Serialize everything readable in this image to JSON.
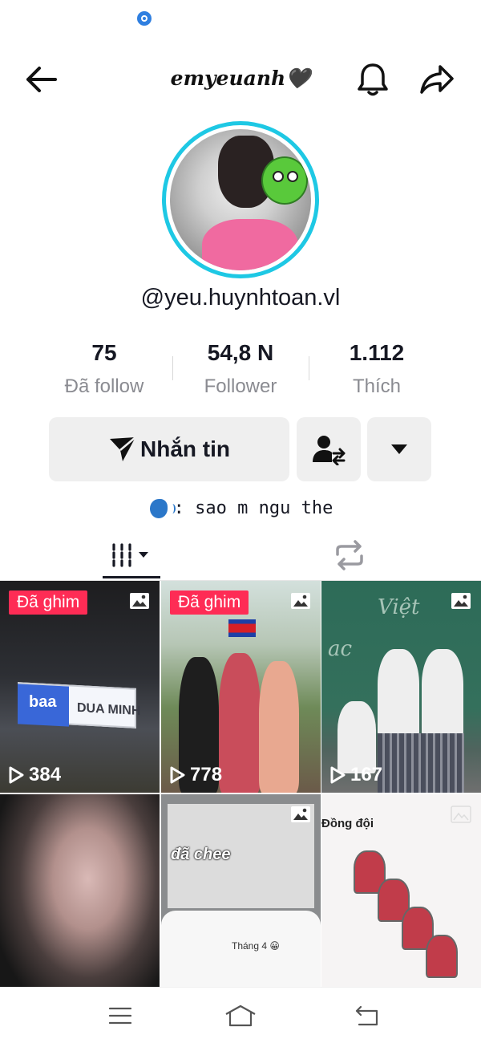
{
  "header": {
    "title": "emyeuanh🖤"
  },
  "profile": {
    "username": "@yeu.huynhtoan.vl",
    "bio_text": ": sao m ngu the"
  },
  "stats": [
    {
      "value": "75",
      "label": "Đã follow"
    },
    {
      "value": "54,8 N",
      "label": "Follower"
    },
    {
      "value": "1.112",
      "label": "Thích"
    }
  ],
  "actions": {
    "message_label": "Nhắn tin"
  },
  "icons": {
    "back": "arrow-left-icon",
    "notifications": "bell-icon",
    "share": "share-icon",
    "send": "paper-plane-icon",
    "suggest": "user-swap-icon",
    "more": "caret-down-icon",
    "videos_tab": "grid-columns-icon",
    "reposts_tab": "repost-icon",
    "nav_menu": "menu-icon",
    "nav_home": "home-icon",
    "nav_back": "back-icon"
  },
  "videos": [
    {
      "pinned_label": "Đã ghim",
      "views": "384",
      "sign_left": "baa",
      "sign_right": "DUA MINH"
    },
    {
      "pinned_label": "Đã ghim",
      "views": "778"
    },
    {
      "views": "167",
      "chalk_1": "Việt",
      "chalk_2": "ac"
    },
    {
      "views": ""
    },
    {
      "views": "",
      "overlay_text": "đã chee",
      "sheet_text": "Tháng 4 😀"
    },
    {
      "views": "",
      "caption": "Đồng đội"
    }
  ],
  "colors": {
    "accent_pink": "#fe2c55",
    "ring_cyan": "#1ec8e4",
    "button_bg": "#efefef",
    "text_primary": "#161823",
    "text_secondary": "#8a8b91"
  }
}
